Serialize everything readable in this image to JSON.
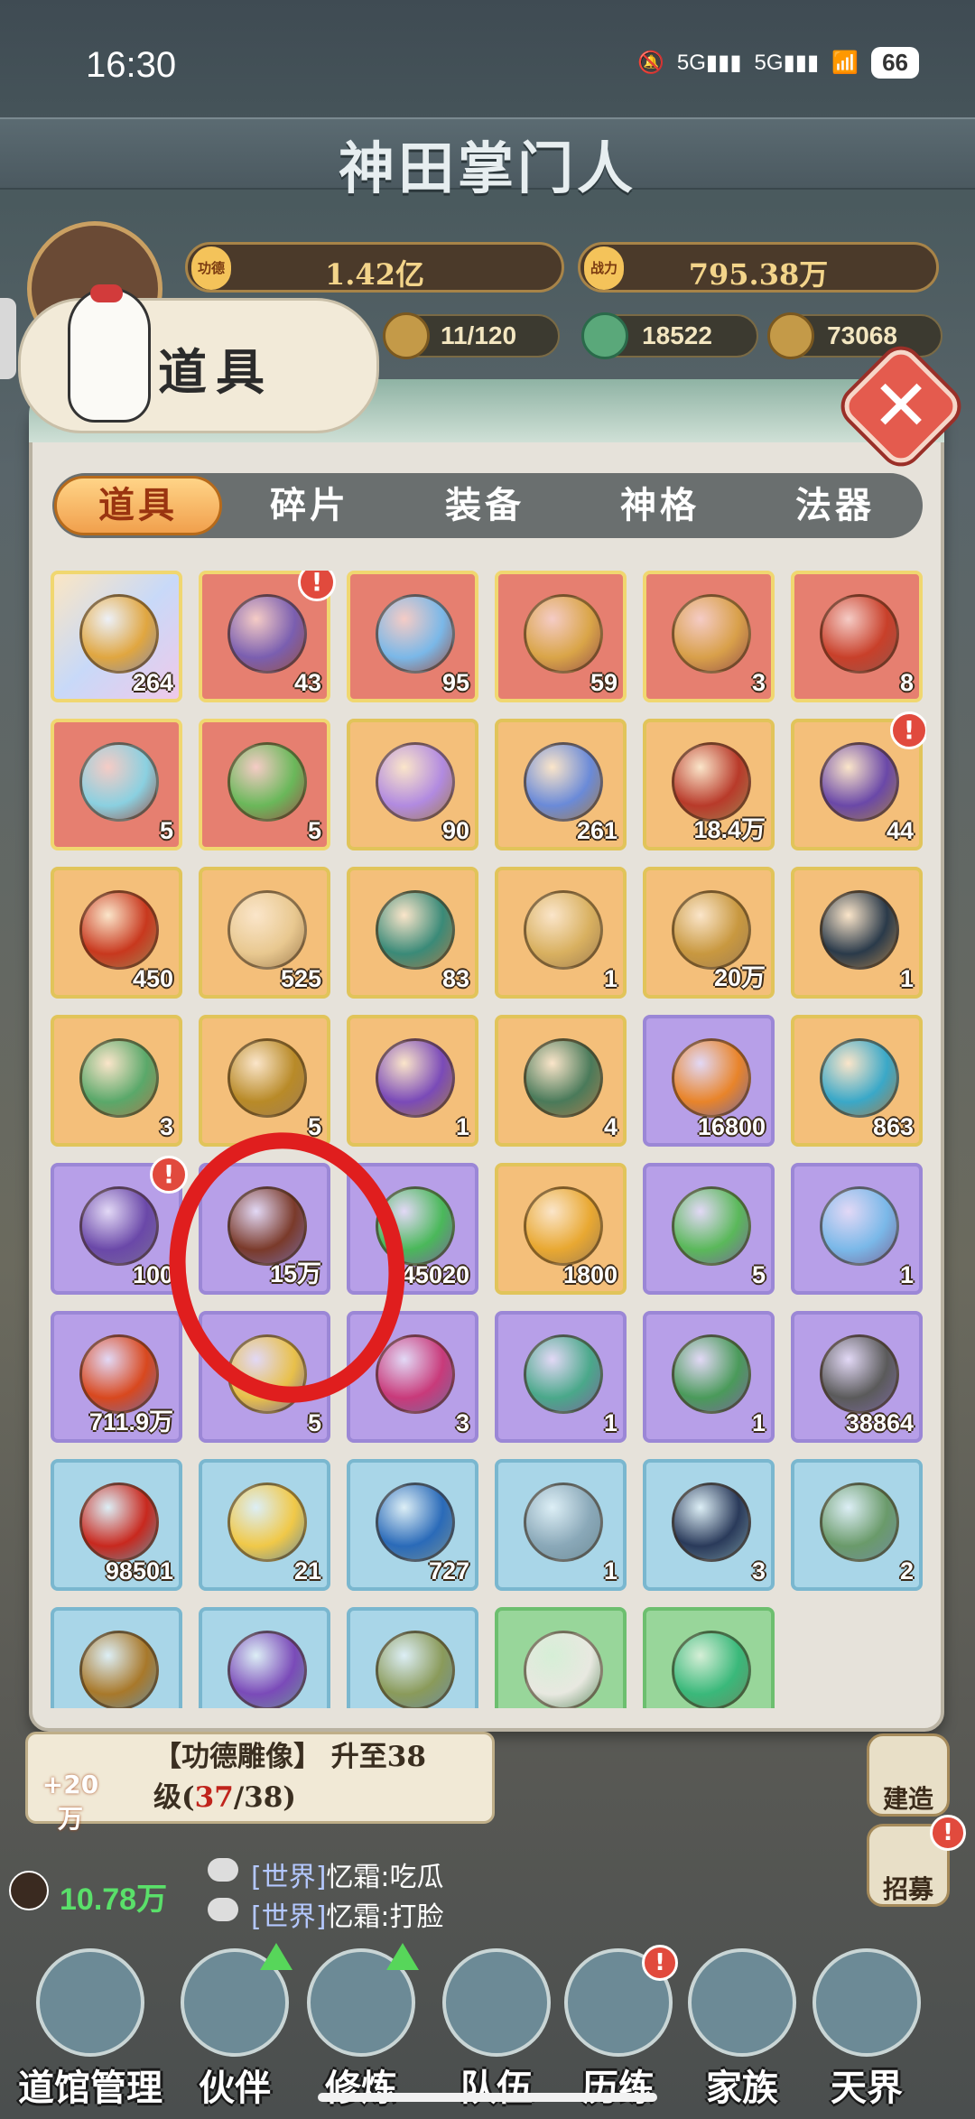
{
  "status_bar": {
    "time": "16:30",
    "signal1": "5G",
    "signal2": "5G",
    "battery": "66"
  },
  "game_title": "神田掌门人",
  "resources": {
    "merit_label": "功德",
    "merit": "1.42亿",
    "power_label": "战力",
    "power": "795.38万",
    "disciples": "11/120",
    "jade": "18522",
    "coins": "73068"
  },
  "panel_title": "道具",
  "tabs": [
    {
      "label": "道具",
      "active": true
    },
    {
      "label": "碎片",
      "active": false
    },
    {
      "label": "装备",
      "active": false
    },
    {
      "label": "神格",
      "active": false
    },
    {
      "label": "法器",
      "active": false
    }
  ],
  "items": [
    {
      "count": "264",
      "rarity": "rainbow",
      "icon": "gold-pouch-icon",
      "color": "#e0a640",
      "alert": false
    },
    {
      "count": "43",
      "rarity": "red",
      "icon": "treasure-chest-icon",
      "color": "#7a5fb0",
      "alert": true
    },
    {
      "count": "95",
      "rarity": "red",
      "icon": "crystal-egg-icon",
      "color": "#7ab8e8",
      "alert": false
    },
    {
      "count": "59",
      "rarity": "red",
      "icon": "golden-hammer-icon",
      "color": "#d9a548",
      "alert": false
    },
    {
      "count": "3",
      "rarity": "red",
      "icon": "golden-key-icon",
      "color": "#d8a04a",
      "alert": false
    },
    {
      "count": "8",
      "rarity": "red",
      "icon": "phoenix-token-icon",
      "color": "#c8402a",
      "alert": false
    },
    {
      "count": "5",
      "rarity": "red",
      "icon": "ice-chest-icon",
      "color": "#8ad0e0",
      "alert": false
    },
    {
      "count": "5",
      "rarity": "red",
      "icon": "jade-gourd-icon",
      "color": "#6ab85a",
      "alert": false
    },
    {
      "count": "90",
      "rarity": "orange",
      "icon": "spirit-stone-pile-icon",
      "color": "#b18ae0",
      "alert": false
    },
    {
      "count": "261",
      "rarity": "orange",
      "icon": "crystal-shard-icon",
      "color": "#6a8ad8",
      "alert": false
    },
    {
      "count": "18.4万",
      "rarity": "orange",
      "icon": "fire-gem-icon",
      "color": "#b83a2a",
      "alert": false
    },
    {
      "count": "44",
      "rarity": "orange",
      "icon": "purple-chest-icon",
      "color": "#6a48a8",
      "alert": true
    },
    {
      "count": "450",
      "rarity": "orange",
      "icon": "fortune-orb-icon",
      "color": "#c8381e",
      "alert": false
    },
    {
      "count": "525",
      "rarity": "orange",
      "icon": "talisman-card-icon",
      "color": "#e8c890",
      "alert": false
    },
    {
      "count": "83",
      "rarity": "orange",
      "icon": "jade-crystal-icon",
      "color": "#3a8a78",
      "alert": false
    },
    {
      "count": "1",
      "rarity": "orange",
      "icon": "battle-token-icon",
      "color": "#d8b060",
      "alert": false
    },
    {
      "count": "20万",
      "rarity": "orange",
      "icon": "tribute-medal-icon",
      "color": "#c89840",
      "alert": false
    },
    {
      "count": "1",
      "rarity": "orange",
      "icon": "dark-scroll-icon",
      "color": "#2a3a4a",
      "alert": false
    },
    {
      "count": "3",
      "rarity": "orange",
      "icon": "jade-dragon-icon",
      "color": "#5aa86a",
      "alert": false
    },
    {
      "count": "5",
      "rarity": "orange",
      "icon": "golden-seal-icon",
      "color": "#b88a28",
      "alert": false
    },
    {
      "count": "1",
      "rarity": "orange",
      "icon": "purple-scroll-icon",
      "color": "#7a4ab8",
      "alert": false
    },
    {
      "count": "4",
      "rarity": "orange",
      "icon": "book-scroll-icon",
      "color": "#4a7a5a",
      "alert": false
    },
    {
      "count": "16800",
      "rarity": "purple",
      "icon": "amber-stone-icon",
      "color": "#e8842a",
      "alert": false
    },
    {
      "count": "863",
      "rarity": "orange",
      "icon": "blue-crystal-pile-icon",
      "color": "#3aa8c8",
      "alert": false
    },
    {
      "count": "100",
      "rarity": "purple",
      "icon": "purple-chest-icon",
      "color": "#6a48a8",
      "alert": true
    },
    {
      "count": "15万",
      "rarity": "purple",
      "icon": "prayer-beads-icon",
      "color": "#7a3a2a",
      "alert": false
    },
    {
      "count": "45020",
      "rarity": "purple",
      "icon": "jade-spirit-icon",
      "color": "#4ab85a",
      "alert": false
    },
    {
      "count": "1800",
      "rarity": "orange",
      "icon": "golden-orb-icon",
      "color": "#e8a832",
      "alert": false
    },
    {
      "count": "5",
      "rarity": "purple",
      "icon": "jade-pendant-icon",
      "color": "#5ab85a",
      "alert": false
    },
    {
      "count": "1",
      "rarity": "purple",
      "icon": "shield-crystal-icon",
      "color": "#7ab8e8",
      "alert": false
    },
    {
      "count": "711.9万",
      "rarity": "purple",
      "icon": "fire-eye-icon",
      "color": "#d8481e",
      "alert": false
    },
    {
      "count": "5",
      "rarity": "purple",
      "icon": "golden-crown-icon",
      "color": "#e8c04a",
      "alert": false
    },
    {
      "count": "3",
      "rarity": "purple",
      "icon": "rose-coin-icon",
      "color": "#c83a7a",
      "alert": false
    },
    {
      "count": "1",
      "rarity": "purple",
      "icon": "jade-ruyi-icon",
      "color": "#4aa88a",
      "alert": false
    },
    {
      "count": "1",
      "rarity": "purple",
      "icon": "jade-pagoda-icon",
      "color": "#4a9a5a",
      "alert": false
    },
    {
      "count": "38864",
      "rarity": "purple",
      "icon": "iron-ore-icon",
      "color": "#5a5a5a",
      "alert": false
    },
    {
      "count": "98501",
      "rarity": "blue",
      "icon": "red-spirit-orb-icon",
      "color": "#c8281e",
      "alert": false
    },
    {
      "count": "21",
      "rarity": "blue",
      "icon": "golden-egg-icon",
      "color": "#f0c848",
      "alert": false
    },
    {
      "count": "727",
      "rarity": "blue",
      "icon": "blue-phoenix-orb-icon",
      "color": "#2a6ab8",
      "alert": false
    },
    {
      "count": "1",
      "rarity": "blue",
      "icon": "stone-lion-seal-icon",
      "color": "#8aa8b8",
      "alert": false
    },
    {
      "count": "3",
      "rarity": "blue",
      "icon": "manual-book-icon",
      "color": "#2a3a5a",
      "alert": false
    },
    {
      "count": "2",
      "rarity": "blue",
      "icon": "bronze-cauldron-icon",
      "color": "#6a9a6a",
      "alert": false
    },
    {
      "count": "",
      "rarity": "blue",
      "icon": "golden-book-icon",
      "color": "#a8782a",
      "alert": false
    },
    {
      "count": "",
      "rarity": "blue",
      "icon": "purple-dragon-seal-icon",
      "color": "#7a4ab8",
      "alert": false
    },
    {
      "count": "",
      "rarity": "blue",
      "icon": "jade-dragon-seal-icon",
      "color": "#8a9a5a",
      "alert": false
    },
    {
      "count": "",
      "rarity": "green",
      "icon": "white-egg-icon",
      "color": "#e8e8e0",
      "alert": false
    },
    {
      "count": "",
      "rarity": "green",
      "icon": "green-orb-icon",
      "color": "#3ab87a",
      "alert": false
    }
  ],
  "quest": {
    "badge": "+20万",
    "line1": "【功德雕像】 升至38",
    "line2_prefix": "级(",
    "line2_progress": "37",
    "line2_suffix": "/38)"
  },
  "side_buttons": [
    {
      "label": "建造",
      "alert": false
    },
    {
      "label": "招募",
      "alert": true
    }
  ],
  "score": "10.78万",
  "chat": [
    {
      "channel": "[世界]",
      "text": "忆霜:吃瓜"
    },
    {
      "channel": "[世界]",
      "text": "忆霜:打脸"
    }
  ],
  "bottom_nav": [
    {
      "label": "道馆管理",
      "alert": false,
      "upgrade": false
    },
    {
      "label": "伙伴",
      "alert": false,
      "upgrade": true
    },
    {
      "label": "修炼",
      "alert": false,
      "upgrade": true
    },
    {
      "label": "队伍",
      "alert": false,
      "upgrade": false
    },
    {
      "label": "历练",
      "alert": true,
      "upgrade": false
    },
    {
      "label": "家族",
      "alert": false,
      "upgrade": false
    },
    {
      "label": "天界",
      "alert": false,
      "upgrade": false
    }
  ],
  "colors": {
    "accent_red": "#e14a3d",
    "tab_active": "#f1a04d",
    "panel_bg": "#e6e2da",
    "annotation_circle": "#e01e1e"
  }
}
